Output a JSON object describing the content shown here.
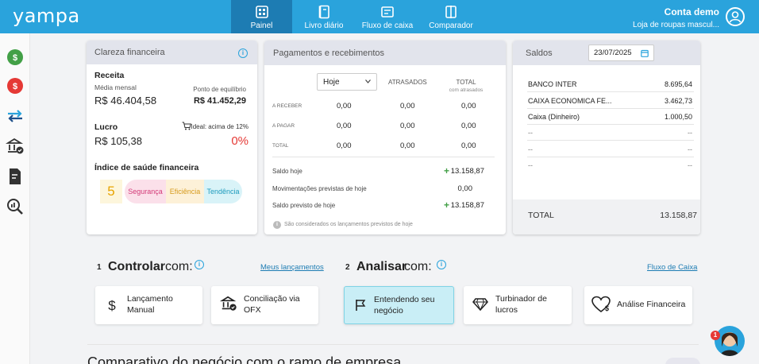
{
  "app": {
    "logo": "yampa"
  },
  "nav": [
    {
      "label": "Painel",
      "icon": "dashboard-icon",
      "active": true
    },
    {
      "label": "Livro diário",
      "icon": "journal-icon",
      "active": false
    },
    {
      "label": "Fluxo de caixa",
      "icon": "cashflow-icon",
      "active": false
    },
    {
      "label": "Comparador",
      "icon": "compare-icon",
      "active": false
    }
  ],
  "account": {
    "name": "Conta demo",
    "store": "Loja de roupas mascul..."
  },
  "sidebar": [
    "income-icon",
    "expense-icon",
    "transfer-icon",
    "bank-check-icon",
    "document-edit-icon",
    "analysis-icon"
  ],
  "clareza": {
    "title": "Clareza financeira",
    "receita_label": "Receita",
    "media_label": "Média mensal",
    "receita_value": "R$ 46.404,58",
    "equilibrio_label": "Ponto de equilíbrio",
    "equilibrio_value": "R$ 41.452,29",
    "lucro_label": "Lucro",
    "ideal_label": "Ideal: acima de 12%",
    "lucro_value": "R$ 105,38",
    "lucro_pct": "0%",
    "indice_label": "Índice de saúde financeira",
    "score": "5",
    "tags": [
      "Segurança",
      "Eficiência",
      "Tendência"
    ]
  },
  "pagamentos": {
    "title": "Pagamentos e recebimentos",
    "period": "Hoje",
    "col_atrasados": "ATRASADOS",
    "col_total": "TOTAL",
    "col_total_sub": "com atrasados",
    "rows": [
      {
        "label": "A RECEBER",
        "v1": "0,00",
        "v2": "0,00",
        "v3": "0,00"
      },
      {
        "label": "A PAGAR",
        "v1": "0,00",
        "v2": "0,00",
        "v3": "0,00"
      },
      {
        "label": "TOTAL",
        "v1": "0,00",
        "v2": "0,00",
        "v3": "0,00"
      }
    ],
    "saldo_hoje_label": "Saldo hoje",
    "saldo_hoje": "13.158,87",
    "mov_label": "Movimentações previstas de hoje",
    "mov_value": "0,00",
    "previsto_label": "Saldo previsto de hoje",
    "previsto_value": "13.158,87",
    "note": "São considerados os lançamentos previstos de hoje"
  },
  "saldos": {
    "title": "Saldos",
    "date": "23/07/2025",
    "rows": [
      {
        "name": "BANCO INTER",
        "value": "8.695,64"
      },
      {
        "name": "CAIXA ECONOMICA FE...",
        "value": "3.462,73"
      },
      {
        "name": "Caixa (Dinheiro)",
        "value": "1.000,50"
      },
      {
        "name": "--",
        "value": "--"
      },
      {
        "name": "--",
        "value": "--"
      },
      {
        "name": "--",
        "value": "--"
      }
    ],
    "total_label": "TOTAL",
    "total_value": "13.158,87"
  },
  "controlar": {
    "num": "1",
    "title": "Controlar",
    "suffix": "com:",
    "link": "Meus lançamentos"
  },
  "analisar": {
    "num": "2",
    "title": "Analisar",
    "suffix": "com:",
    "link": "Fluxo de Caixa"
  },
  "actions": [
    {
      "label1": "Lançamento",
      "label2": "Manual",
      "icon": "dollar-icon"
    },
    {
      "label1": "Conciliação via",
      "label2": "OFX",
      "icon": "bank-check-icon"
    },
    {
      "label1": "Entendendo seu",
      "label2": "negócio",
      "icon": "flag-icon"
    },
    {
      "label1": "Turbinador de",
      "label2": "lucros",
      "icon": "diamond-icon"
    },
    {
      "label1": "Análise Financeira",
      "label2": "",
      "icon": "heart-dollar-icon"
    }
  ],
  "bottom_text": "Comparativo do negócio com o ramo de empresa",
  "chat": {
    "badge": "1"
  },
  "colors": {
    "primary": "#2aa3dc",
    "active_nav": "#1d7cb3",
    "negative": "#e53935",
    "positive": "#43a047"
  }
}
